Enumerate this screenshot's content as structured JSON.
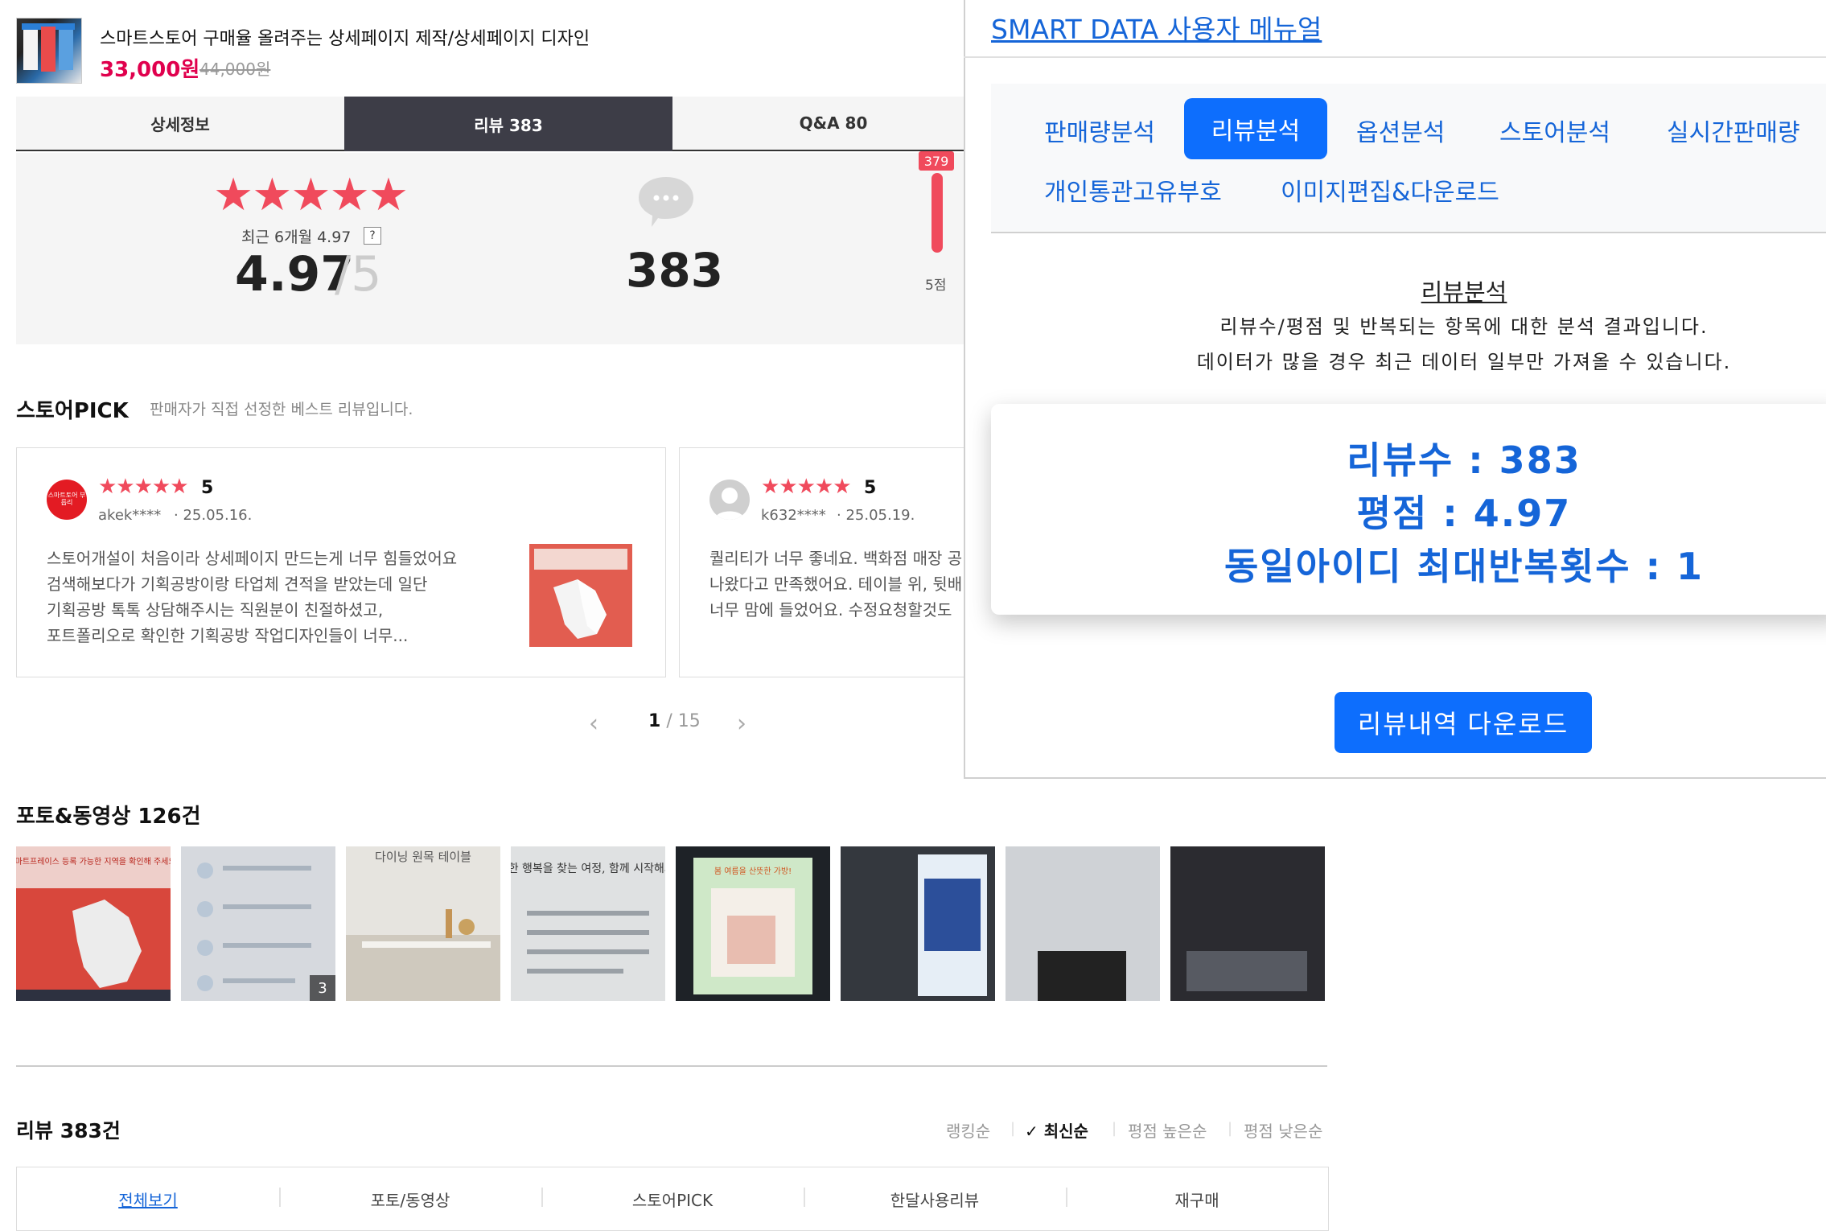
{
  "product": {
    "title": "스마트스토어 구매율 올려주는 상세페이지 제작/상세페이지 디자인",
    "price": "33,000원",
    "original_price": "44,000원"
  },
  "tabs": [
    {
      "label": "상세정보"
    },
    {
      "label": "리뷰 383"
    },
    {
      "label": "Q&A 80"
    }
  ],
  "summary": {
    "stars": "★★★★★",
    "recent_label": "최근 6개월 4.97",
    "help_mark": "?",
    "rating": "4.97",
    "rating_max": "/5",
    "review_count": "383",
    "bar_count": "379",
    "bar_label": "5점",
    "bar_fill_fraction": 0.99
  },
  "store_pick": {
    "title": "스토어PICK",
    "description": "판매자가 직접 선정한 베스트 리뷰입니다.",
    "cards": [
      {
        "stars": "★★★★★",
        "score": "5",
        "user": "akek****",
        "date": "· 25.05.16.",
        "avatar_text": "스마트토어 부릅리 ",
        "lines": [
          "스토어개설이 처음이라 상세페이지 만드는게 너무 힘들었어요",
          "검색해보다가 기획공방이랑 타업체 견적을 받았는데 일단",
          "기획공방 톡톡 상담해주시는 직원분이 친절하셨고,",
          "포트폴리오로 확인한 기획공방 작업디자인들이 너무..."
        ]
      },
      {
        "stars": "★★★★★",
        "score": "5",
        "user": "k632****",
        "date": "· 25.05.19.",
        "lines": [
          "퀄리티가 너무 좋네요. 백화점 매장 공",
          "나왔다고 만족했어요. 테이블 위, 뒷배",
          "너무 맘에 들었어요. 수정요청할것도"
        ]
      }
    ],
    "pager": {
      "current": "1",
      "total": "/ 15",
      "prev": "‹",
      "next": "›"
    }
  },
  "photos": {
    "title": "포토&동영상 126건",
    "items": [
      {
        "caption": "스마트프레이스 등록 가능한 지역을 확인해 주세요!"
      },
      {
        "caption": "",
        "badge": "3"
      },
      {
        "caption": "다이닝 원목 테이블"
      },
      {
        "caption": "진정한 행복을 찾는 여정, 함께 시작해봐요."
      },
      {
        "caption": "봄 여름을 산뜻한 가방!"
      },
      {
        "caption": ""
      },
      {
        "caption": ""
      },
      {
        "caption": ""
      }
    ]
  },
  "reviews_header": {
    "count": "리뷰 383건",
    "sort": [
      "랭킹순",
      "최신순",
      "평점 높은순",
      "평점 낮은순"
    ],
    "sort_active_check": "✓"
  },
  "filters": [
    "전체보기",
    "포토/동영상",
    "스토어PICK",
    "한달사용리뷰",
    "재구매"
  ],
  "smart_data": {
    "title": "SMART DATA 사용자 메뉴얼",
    "menu_row1": [
      "판매량분석",
      "리뷰분석",
      "옵션분석",
      "스토어분석",
      "실시간판매량"
    ],
    "menu_row2": [
      "개인통관고유부호",
      "이미지편집&다운로드"
    ],
    "section_title": "리뷰분석",
    "desc_line1": "리뷰수/평점 및 반복되는 항목에 대한 분석 결과입니다.",
    "desc_line2": "데이터가 많을 경우 최근 데이터 일부만 가져올 수 있습니다.",
    "result_count": "리뷰수 : 383",
    "result_rating": "평점 : 4.97",
    "result_repeat": "동일아이디 최대반복횟수 : 1",
    "download_button": "리뷰내역 다운로드"
  },
  "colors": {
    "accent_red": "#f04a5c",
    "price_red": "#e0004d",
    "smart_blue": "#1565d8",
    "button_blue": "#0d6efd"
  }
}
